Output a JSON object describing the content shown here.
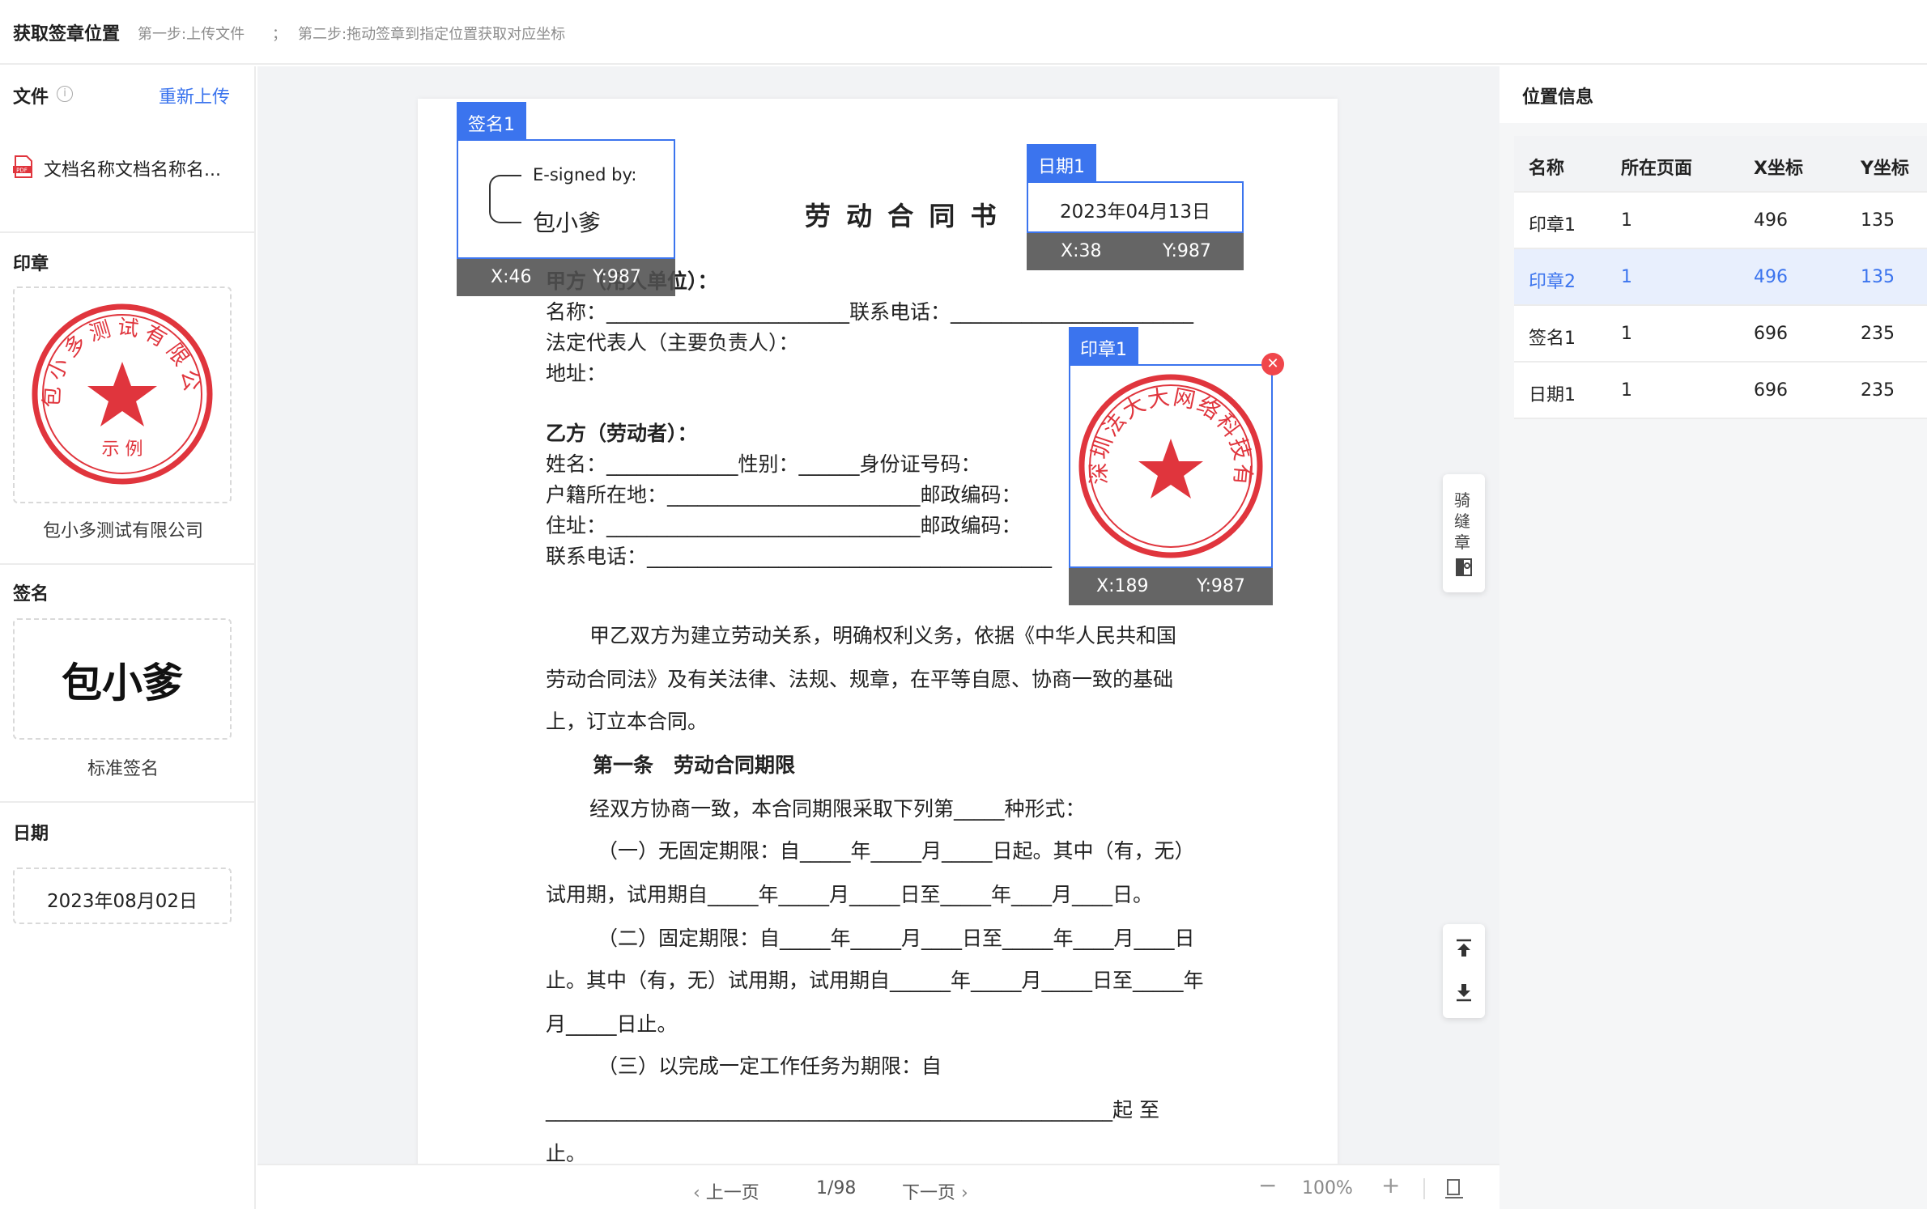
{
  "header": {
    "title": "获取签章位置",
    "step1": "第一步:上传文件",
    "sep": "；",
    "step2": "第二步:拖动签章到指定位置获取对应坐标"
  },
  "left": {
    "file_title": "文件",
    "reupload": "重新上传",
    "file_name": "文档名称文档名称名...",
    "seal_title": "印章",
    "seal_caption": "包小多测试有限公司",
    "seal_text": "包小多测试有限公司",
    "seal_sub": "示 例",
    "sign_title": "签名",
    "sign_text": "包小爹",
    "sign_caption": "标准签名",
    "date_title": "日期",
    "date_value": "2023年08月02日"
  },
  "doc": {
    "title": "劳 动 合 同 书",
    "lines": [
      "甲方（用人单位）：",
      "名称：________________________联系电话：________________________",
      "法定代表人（主要负责人）：",
      "地址：",
      "乙方（劳动者）：",
      "姓名：_____________性别：______身份证号码：",
      "户籍所在地：_________________________邮政编码：",
      "住址：_______________________________邮政编码：",
      "联系电话：________________________________________",
      "甲乙双方为建立劳动关系，明确权利义务，依据《中华人民共和国",
      "劳动合同法》及有关法律、法规、规章，在平等自愿、协商一致的基础",
      "上，订立本合同。",
      "第一条　劳动合同期限",
      "经双方协商一致，本合同期限采取下列第_____种形式：",
      "（一）无固定期限：自_____年_____月_____日起。其中（有，无）",
      "试用期，试用期自_____年_____月_____日至_____年____月____日。",
      "（二）固定期限：自_____年_____月____日至_____年____月____日",
      "止。其中（有，无）试用期，试用期自______年_____月_____日至_____年",
      "月_____日止。",
      "（三）以完成一定工作任务为期限：自",
      "________________________________________________________起 至",
      "止。"
    ]
  },
  "overlays": {
    "sign1": {
      "tag": "签名1",
      "esigned": "E-signed by:",
      "name": "包小爹",
      "x": "X:46",
      "y": "Y:987"
    },
    "date1": {
      "tag": "日期1",
      "value": "2023年04月13日",
      "x": "X:38",
      "y": "Y:987"
    },
    "seal1": {
      "tag": "印章1",
      "seal_text": "深圳法大大网络科技有限公司",
      "x": "X:189",
      "y": "Y:987"
    }
  },
  "side_tools": {
    "qifeng": [
      "骑",
      "缝",
      "章"
    ]
  },
  "bottom": {
    "prev": "上一页",
    "page": "1/98",
    "next": "下一页",
    "zoom": "100%"
  },
  "right": {
    "title": "位置信息",
    "columns": [
      "名称",
      "所在页面",
      "X坐标",
      "Y坐标"
    ],
    "rows": [
      [
        "印章1",
        "1",
        "496",
        "135"
      ],
      [
        "印章2",
        "1",
        "496",
        "135"
      ],
      [
        "签名1",
        "1",
        "696",
        "235"
      ],
      [
        "日期1",
        "1",
        "696",
        "235"
      ]
    ],
    "active_row": 1
  },
  "colors": {
    "accent": "#3b74ee",
    "seal_red": "#e0353d"
  }
}
